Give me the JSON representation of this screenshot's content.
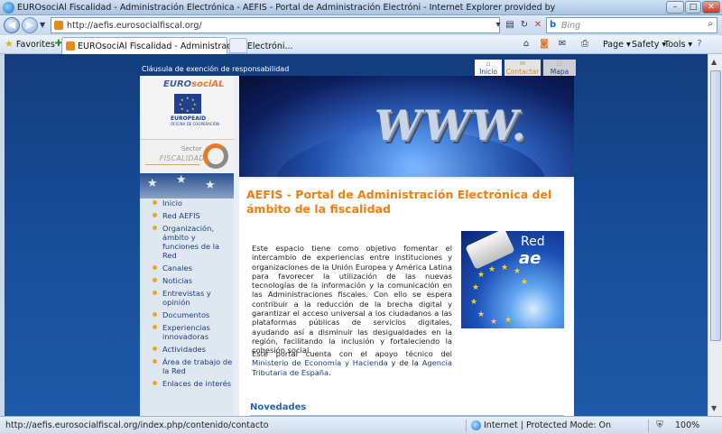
{
  "window": {
    "title": "EUROsociAl Fiscalidad - Administración Electrónica - AEFIS - Portal de Administración Electróni - Internet Explorer provided by",
    "minimize": "–",
    "maximize": "□",
    "close": "✕"
  },
  "address_bar": {
    "url": "http://aefis.eurosocialfiscal.org/",
    "search_placeholder": "Bing"
  },
  "favorites_bar": {
    "favorites_label": "Favorites",
    "tab_title": "EUROsociAl Fiscalidad - Administración Electróni...",
    "commands": [
      "Page ▾",
      "Safety ▾",
      "Tools ▾"
    ]
  },
  "page": {
    "disclaimer": "Cláusula de exención de responsabilidad",
    "top_tabs": [
      {
        "label": "Inicio",
        "color": "#1a3f86",
        "bg": "#ffffff"
      },
      {
        "label": "Contactar",
        "color": "#f07f12",
        "bg": "#e4e4e4"
      },
      {
        "label": "Mapa web",
        "color": "#1a3f86",
        "bg": "#cfcfcf"
      }
    ],
    "logo": {
      "euro": "EURO",
      "social": "sociAL",
      "europeaid": "EUROPEAID",
      "europeaid_sub": "OFICINA DE COOPERACIÓN",
      "sector": "Sector",
      "fiscalidad": "FISCALIDAD"
    },
    "menu": [
      "Inicio",
      "Red AEFIS",
      "Organización, ámbito y funciones de la Red",
      "Canales",
      "Noticias",
      "Entrevistas y opinión",
      "Documentos",
      "Experiencias innovadoras",
      "Actividades",
      "Área de trabajo de la Red",
      "Enlaces de interés"
    ],
    "banner_text": "WWW.",
    "heading": "AEFIS - Portal de Administración Electrónica del ámbito de la fiscalidad",
    "paragraph1": "Este espacio tiene como objetivo fomentar el intercambio de experiencias entre instituciones y organizaciones de la Unión Europea y América Latina para favorecer la utilización de las nuevas tecnologías de la información y la comunicación en las Administraciones fiscales. Con ello se espera contribuir a la reducción de la brecha digital y garantizar el acceso universal a los ciudadanos a las plataformas públicas de servicios digitales, ayudando así a disminuir las desigualdades en la región, facilitando la inclusión y fortaleciendo la cohesión social.",
    "paragraph2_pre": "Este portal cuenta con el apoyo técnico del ",
    "paragraph2_link1": "Ministerio de Economía y Hacienda",
    "paragraph2_mid": " y de la ",
    "paragraph2_link2": "Agencia Tributaria de España",
    "paragraph2_post": ".",
    "red_image": {
      "red": "Red",
      "ae": "ae"
    },
    "novedades": "Novedades"
  },
  "status_bar": {
    "url": "http://aefis.eurosocialfiscal.org/index.php/contenido/contacto",
    "zone": "Internet | Protected Mode: On",
    "zoom": "100%"
  },
  "colors": {
    "accent_orange": "#f07f12",
    "link_blue": "#1a3f86",
    "page_bg_blue": "#174a94"
  }
}
